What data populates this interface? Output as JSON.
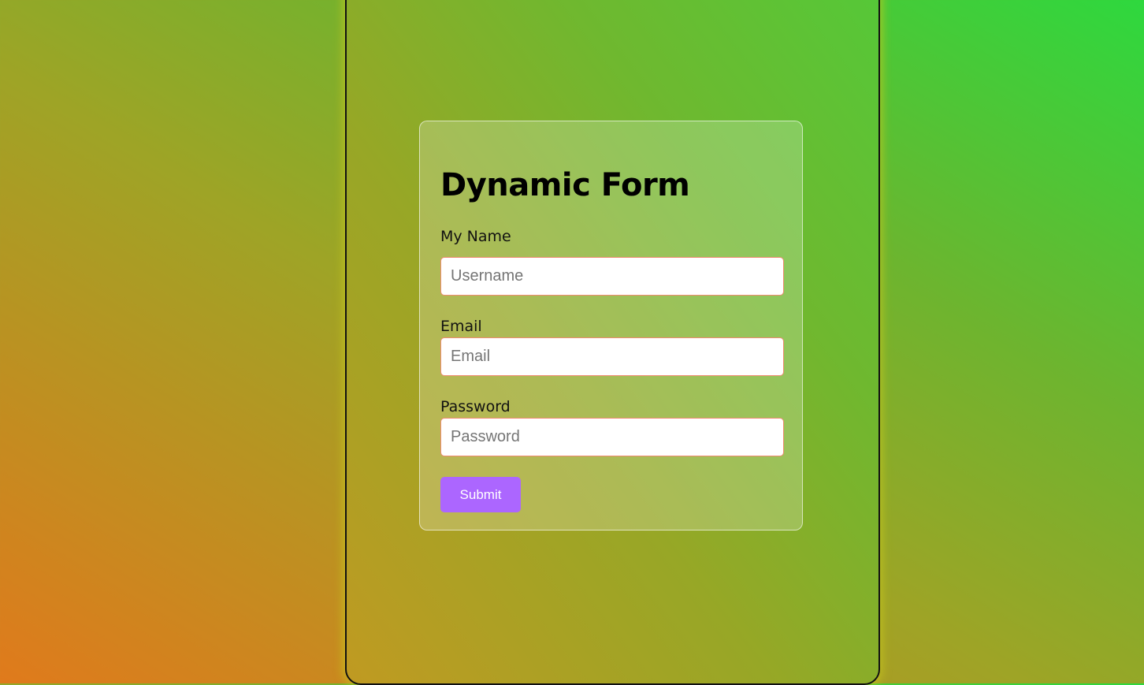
{
  "form": {
    "title": "Dynamic Form",
    "fields": [
      {
        "label": "My Name",
        "placeholder": "Username"
      },
      {
        "label": "Email",
        "placeholder": "Email"
      },
      {
        "label": "Password",
        "placeholder": "Password"
      }
    ],
    "submit_label": "Submit"
  },
  "colors": {
    "accent": "#ac66ff",
    "input_border": "#f08a70",
    "gradient_start": "#e07a1c",
    "gradient_end": "#2ed83e"
  }
}
